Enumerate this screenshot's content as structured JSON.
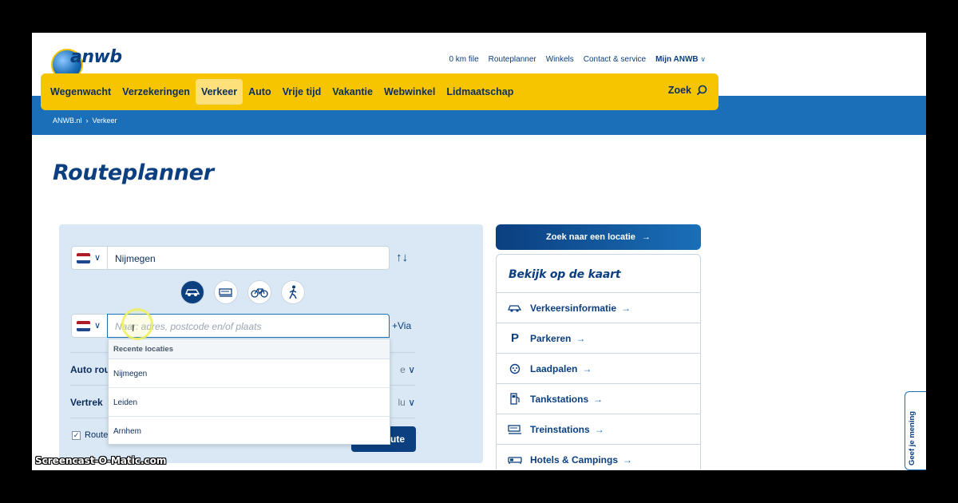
{
  "brand": {
    "logo_text": "anwb"
  },
  "top_links": [
    "0 km file",
    "Routeplanner",
    "Winkels",
    "Contact & service"
  ],
  "account_label": "Mijn ANWB",
  "nav": {
    "items": [
      "Wegenwacht",
      "Verzekeringen",
      "Verkeer",
      "Auto",
      "Vrije tijd",
      "Vakantie",
      "Webwinkel",
      "Lidmaatschap"
    ],
    "active": "Verkeer",
    "search_label": "Zoek"
  },
  "breadcrumb": {
    "home": "ANWB.nl",
    "separator": "›",
    "current": "Verkeer"
  },
  "page_title": "Routeplanner",
  "planner": {
    "from_value": "Nijmegen",
    "to_placeholder": "Naar: adres, postcode en/of plaats",
    "via_label": "+Via",
    "modes": [
      "car-icon",
      "train-icon",
      "bicycle-icon",
      "walking-icon"
    ],
    "active_mode": "car-icon",
    "route_row_label": "Auto rou",
    "route_row_value": "e",
    "depart_row_label": "Vertrek",
    "depart_row_value": "lu",
    "checkbox_label": "Route",
    "plan_button": "ute"
  },
  "dropdown": {
    "header": "Recente locaties",
    "items": [
      "Nijmegen",
      "Leiden",
      "Arnhem"
    ]
  },
  "location_button": "Zoek naar een locatie",
  "map_panel": {
    "title": "Bekijk op de kaart",
    "items": [
      {
        "label": "Verkeersinformatie",
        "icon": "car-icon"
      },
      {
        "label": "Parkeren",
        "icon": "parking-icon"
      },
      {
        "label": "Laadpalen",
        "icon": "charging-icon"
      },
      {
        "label": "Tankstations",
        "icon": "fuel-pump-icon"
      },
      {
        "label": "Treinstations",
        "icon": "train-icon"
      },
      {
        "label": "Hotels & Campings",
        "icon": "bed-icon"
      }
    ]
  },
  "feedback_tab": "Geef je mening",
  "watermark": "Screencast-O-Matic.com",
  "colors": {
    "brand_blue": "#0b3f80",
    "accent_blue": "#1a6fb8",
    "nav_yellow": "#f7c500"
  }
}
